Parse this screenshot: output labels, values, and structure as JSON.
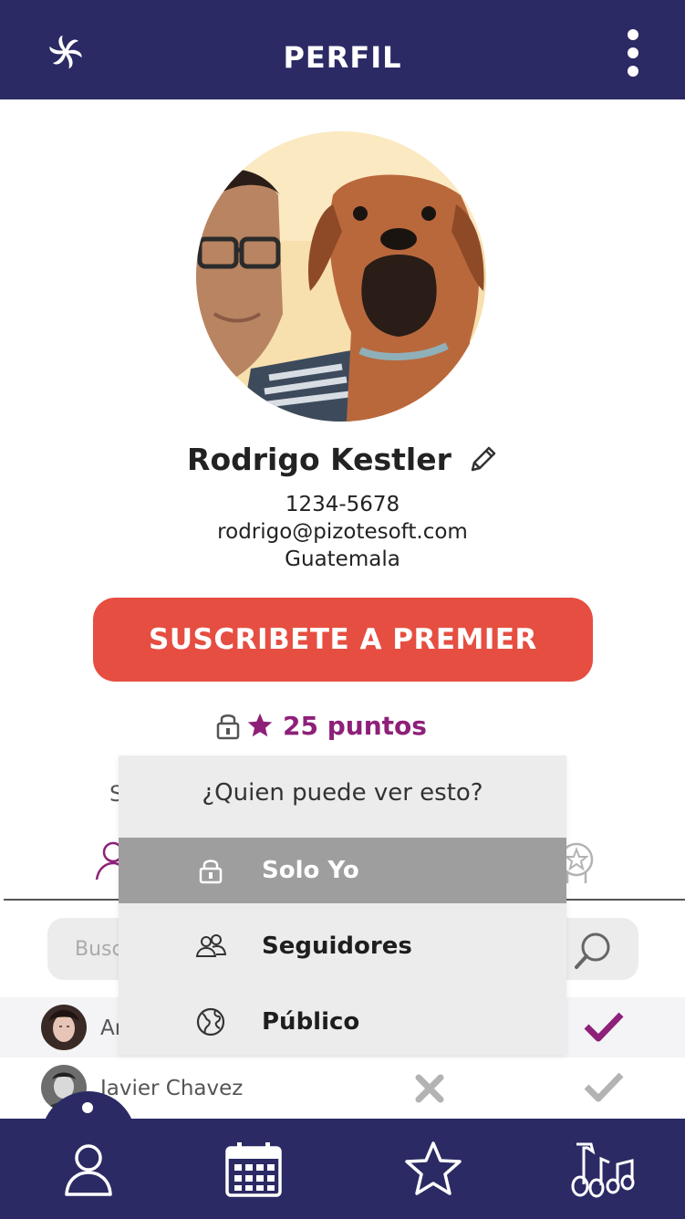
{
  "header": {
    "title": "PERFIL",
    "logo_icon": "pinwheel-logo-icon",
    "menu_icon": "kebab-menu-icon",
    "background": "#2b2a64"
  },
  "profile": {
    "photo": "profile-photo-man-with-boxer-dog",
    "name": "Rodrigo Kestler",
    "phone": "1234-5678",
    "email": "rodrigo@pizotesoft.com",
    "country": "Guatemala"
  },
  "premier_button": {
    "label": "SUSCRIBETE A PREMIER",
    "color": "#e64e42"
  },
  "points": {
    "label": "25 puntos",
    "color": "#8e2079",
    "privacy_icon": "lock-icon",
    "star_icon": "star-icon"
  },
  "obscured": {
    "tab_text_fragment": "S"
  },
  "search": {
    "placeholder": "Busc",
    "icon": "search-icon"
  },
  "followers": [
    {
      "name": "An",
      "avatar": "woman-avatar",
      "checked": true,
      "check_color": "#8e2079"
    },
    {
      "name": "Javier Chavez",
      "avatar": "man-avatar",
      "checked": false,
      "check_color": "#b3b3b3"
    }
  ],
  "privacy_popup": {
    "question": "¿Quien puede ver esto?",
    "options": [
      {
        "label": "Solo Yo",
        "icon": "lock-icon",
        "selected": true
      },
      {
        "label": "Seguidores",
        "icon": "people-icon",
        "selected": false
      },
      {
        "label": "Público",
        "icon": "globe-icon",
        "selected": false
      }
    ]
  },
  "bottom_nav": {
    "items": [
      {
        "icon": "profile-icon",
        "active": true
      },
      {
        "icon": "calendar-icon",
        "active": false
      },
      {
        "icon": "star-icon",
        "active": false
      },
      {
        "icon": "music-notes-icon",
        "active": false
      }
    ]
  }
}
